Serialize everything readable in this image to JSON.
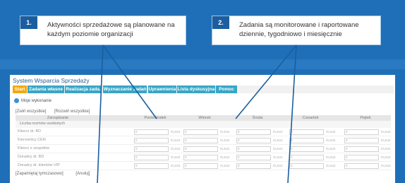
{
  "callouts": [
    {
      "num": "1.",
      "text": "Aktywności sprzedażowe są planowane na każdym poziomie organizacji"
    },
    {
      "num": "2.",
      "text": "Zadania są monitorowane i raportowane dziennie, tygodniowo i miesięcznie"
    }
  ],
  "app": {
    "title": "System Wsparcia Sprzedaży"
  },
  "menu": [
    "Start",
    "Zadania własne",
    "Realizacja zada.",
    "Wyznaczanie zadań",
    "Uprawnienia",
    "Lista dyskusyjna",
    "Pomoc"
  ],
  "section": "Moje wykonanie",
  "links": [
    "[Zwiń wszystkie]",
    "[Rozwiń wszystkie]"
  ],
  "table": {
    "headers": [
      "Zarządzanie",
      "Poniedziałek",
      "Wtorek",
      "Środa",
      "Czwartek",
      "Piątek"
    ],
    "section": "Liczba rozmów osobistych",
    "rows": [
      "Klienci dr. BD",
      "Kierownicy CEN",
      "Klienci z zespołów",
      "Doradcy dr. BD",
      "Doradcy dr. klientów VIP"
    ],
    "value": "0",
    "unit": "/0,2szt"
  },
  "footer": [
    "[Zapamiętaj tymczasowo]",
    "[Anuluj]"
  ]
}
